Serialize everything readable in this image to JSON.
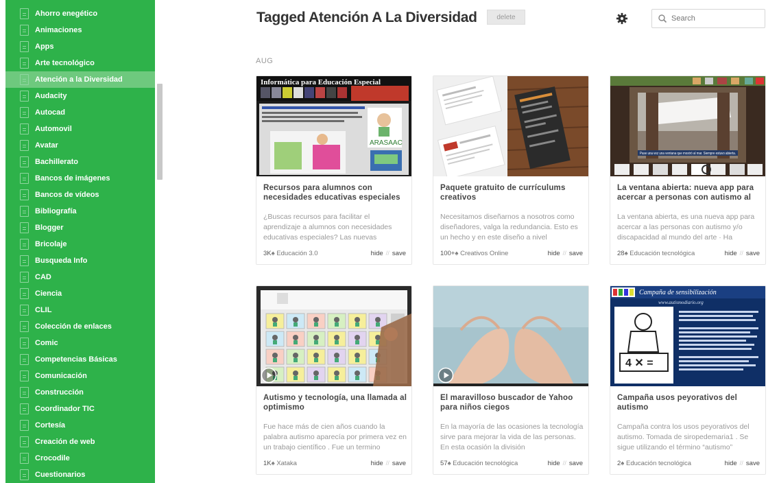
{
  "sidebar": {
    "items": [
      {
        "label": "Ahorro enegético"
      },
      {
        "label": "Animaciones"
      },
      {
        "label": "Apps"
      },
      {
        "label": "Arte tecnológico"
      },
      {
        "label": "Atención a la Diversidad",
        "active": true
      },
      {
        "label": "Audacity"
      },
      {
        "label": "Autocad"
      },
      {
        "label": "Automovil"
      },
      {
        "label": "Avatar"
      },
      {
        "label": "Bachillerato"
      },
      {
        "label": "Bancos de imágenes"
      },
      {
        "label": "Bancos de vídeos"
      },
      {
        "label": "Bibliografía"
      },
      {
        "label": "Blogger"
      },
      {
        "label": "Bricolaje"
      },
      {
        "label": "Busqueda Info"
      },
      {
        "label": "CAD"
      },
      {
        "label": "Ciencia"
      },
      {
        "label": "CLIL"
      },
      {
        "label": "Colección de enlaces"
      },
      {
        "label": "Comic"
      },
      {
        "label": "Competencias Básicas"
      },
      {
        "label": "Comunicación"
      },
      {
        "label": "Construcción"
      },
      {
        "label": "Coordinador TIC"
      },
      {
        "label": "Cortesía"
      },
      {
        "label": "Creación de web"
      },
      {
        "label": "Crocodile"
      },
      {
        "label": "Cuestionarios"
      }
    ],
    "accent_color": "#2eb24a",
    "active_color": "#6ec97e"
  },
  "header": {
    "title": "Tagged Atención A La Diversidad",
    "delete_label": "delete",
    "settings_icon": "gear-icon"
  },
  "search": {
    "placeholder": "Search",
    "icon": "search-icon"
  },
  "feed": {
    "month": "AUG",
    "hide_label": "hide",
    "separator": "//",
    "save_label": "save",
    "flame_glyph": "♠",
    "cards": [
      {
        "title": "Recursos para alumnos con necesidades educativas especiales",
        "excerpt": "¿Buscas recursos para facilitar el aprendizaje a alumnos con necesidades educativas especiales? Las nuevas",
        "count": "3K",
        "source": "Educación 3.0",
        "image_text": "Informática para Educación Especial",
        "image_label": "ARASAAC",
        "video": false
      },
      {
        "title": "Paquete gratuito de currículums creativos",
        "excerpt": "Necesitamos diseñarnos a nosotros como diseñadores, valga la redundancia. Esto es un hecho y en este diseño a nivel",
        "count": "100+",
        "source": "Creativos Online",
        "video": false
      },
      {
        "title": "La ventana abierta: nueva app para acercar a personas con autismo al",
        "excerpt": "La ventana abierta, es una nueva app para acercar a las personas con autismo y/o discapacidad al mundo del arte · Ha",
        "count": "28",
        "source": "Educación tecnológica",
        "image_text": "Pase una vez una ventana que mostró al mar. Siempre estuvo abierta.",
        "video": false
      },
      {
        "title": "Autismo y tecnología, una llamada al optimismo",
        "excerpt": "Fue hace más de cien años cuando la palabra autismo aparecía por primera vez en un trabajo científico . Fue un termino",
        "count": "1K",
        "source": "Xataka",
        "video": true
      },
      {
        "title": "El maravilloso buscador de Yahoo para niños ciegos",
        "excerpt": "En la mayoría de las ocasiones la tecnología sirve para mejorar la vida de las personas. En esta ocasión la división",
        "count": "57",
        "source": "Educación tecnológica",
        "video": true
      },
      {
        "title": "Campaña usos peyorativos del autismo",
        "excerpt": "Campaña contra los usos peyorativos del autismo. Tomada de siropedemaria1 . Se sigue utilizando el término “autismo”",
        "count": "2",
        "source": "Educación tecnológica",
        "image_text": "Campaña de sensibilización",
        "image_subtext": "www.autismodiario.org",
        "video": false
      }
    ]
  }
}
